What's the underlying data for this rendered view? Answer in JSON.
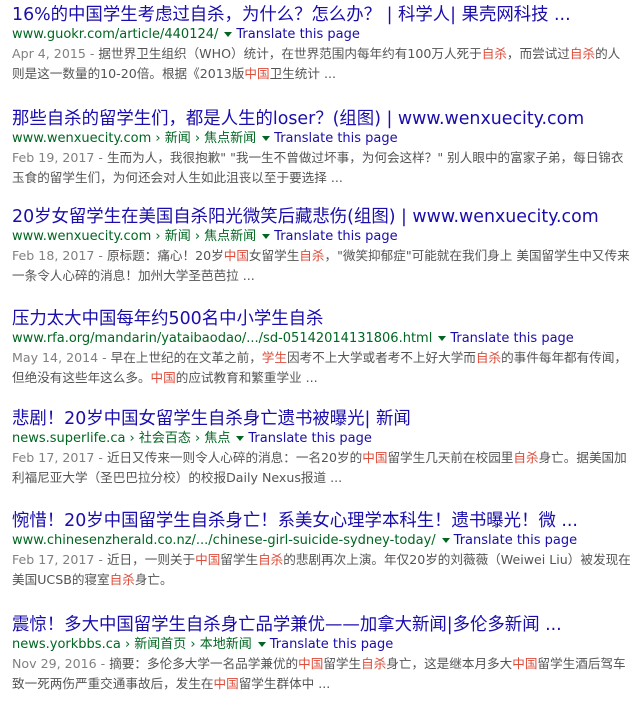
{
  "translate_label": "Translate this page",
  "results": [
    {
      "title": "16%的中国学生考虑过自杀，为什么？怎么办？ | 科学人| 果壳网科技 ...",
      "url": "www.guokr.com/article/440124/",
      "snippet": [
        {
          "t": "Apr 4, 2015 - ",
          "c": "date"
        },
        {
          "t": "据世界卫生组织（WHO）统计，在世界范围内每年约有100万人死于",
          "c": ""
        },
        {
          "t": "自杀",
          "c": "hl"
        },
        {
          "t": "，而尝试过",
          "c": ""
        },
        {
          "t": "自杀",
          "c": "hl"
        },
        {
          "t": "的人则是这一数量的10-20倍。根据《2013版",
          "c": ""
        },
        {
          "t": "中国",
          "c": "hl"
        },
        {
          "t": "卫生统计 ...",
          "c": ""
        }
      ]
    },
    {
      "title": "那些自杀的留学生们，都是人生的loser？(组图) | www.wenxuecity.com",
      "url": "www.wenxuecity.com › 新闻 › 焦点新闻",
      "snippet": [
        {
          "t": "Feb 19, 2017 - ",
          "c": "date"
        },
        {
          "t": "生而为人，我很抱歉\" \"我一生不曾做过坏事，为何会这样？\" 别人眼中的富家子弟，每日锦衣玉食的留学生们，为何还会对人生如此沮丧以至于要选择 ...",
          "c": ""
        }
      ]
    },
    {
      "title": "20岁女留学生在美国自杀阳光微笑后藏悲伤(组图) | www.wenxuecity.com",
      "url": "www.wenxuecity.com › 新闻 › 焦点新闻",
      "snippet": [
        {
          "t": "Feb 18, 2017 - ",
          "c": "date"
        },
        {
          "t": "原标题：痛心！20岁",
          "c": ""
        },
        {
          "t": "中国",
          "c": "hl"
        },
        {
          "t": "女留学生",
          "c": ""
        },
        {
          "t": "自杀",
          "c": "hl"
        },
        {
          "t": "，\"微笑抑郁症\"可能就在我们身上 美国留学生中又传来一条令人心碎的消息！加州大学圣芭芭拉 ...",
          "c": ""
        }
      ]
    },
    {
      "title": "压力太大中国每年约500名中小学生自杀",
      "url": "www.rfa.org/mandarin/yataibaodao/.../sd-05142014131806.html",
      "snippet": [
        {
          "t": "May 14, 2014 - ",
          "c": "date"
        },
        {
          "t": "早在上世纪的在文革之前，",
          "c": ""
        },
        {
          "t": "学生",
          "c": "hl"
        },
        {
          "t": "因考不上大学或者考不上好大学而",
          "c": ""
        },
        {
          "t": "自杀",
          "c": "hl"
        },
        {
          "t": "的事件每年都有传闻，但绝没有这些年这么多。",
          "c": ""
        },
        {
          "t": "中国",
          "c": "hl"
        },
        {
          "t": "的应试教育和繁重学业 ...",
          "c": ""
        }
      ]
    },
    {
      "title": "悲剧！20岁中国女留学生自杀身亡遗书被曝光| 新闻",
      "url": "news.superlife.ca › 社会百态 › 焦点",
      "snippet": [
        {
          "t": "Feb 17, 2017 - ",
          "c": "date"
        },
        {
          "t": "近日又传来一则令人心碎的消息：一名20岁的",
          "c": ""
        },
        {
          "t": "中国",
          "c": "hl"
        },
        {
          "t": "留学生几天前在校园里",
          "c": ""
        },
        {
          "t": "自杀",
          "c": "hl"
        },
        {
          "t": "身亡。据美国加利福尼亚大学（圣巴巴拉分校）的校报Daily Nexus报道 ...",
          "c": ""
        }
      ]
    },
    {
      "title": "惋惜！20岁中国留学生自杀身亡！系美女心理学本科生！遗书曝光！微 ...",
      "url": "www.chinesenzherald.co.nz/.../chinese-girl-suicide-sydney-today/",
      "snippet": [
        {
          "t": "Feb 17, 2017 - ",
          "c": "date"
        },
        {
          "t": "近日，一则关于",
          "c": ""
        },
        {
          "t": "中国",
          "c": "hl"
        },
        {
          "t": "留学生",
          "c": ""
        },
        {
          "t": "自杀",
          "c": "hl"
        },
        {
          "t": "的悲剧再次上演。年仅20岁的刘薇薇（Weiwei Liu）被发现在美国UCSB的寝室",
          "c": ""
        },
        {
          "t": "自杀",
          "c": "hl"
        },
        {
          "t": "身亡。",
          "c": ""
        }
      ]
    },
    {
      "title": "震惊！多大中国留学生自杀身亡品学兼优——加拿大新闻|多伦多新闻 ...",
      "url": "news.yorkbbs.ca › 新闻首页 › 本地新闻",
      "snippet": [
        {
          "t": "Nov 29, 2016 - ",
          "c": "date"
        },
        {
          "t": "摘要：多伦多大学一名品学兼优的",
          "c": ""
        },
        {
          "t": "中国",
          "c": "hl"
        },
        {
          "t": "留学生",
          "c": ""
        },
        {
          "t": "自杀",
          "c": "hl"
        },
        {
          "t": "身亡，这是继本月多大",
          "c": ""
        },
        {
          "t": "中国",
          "c": "hl"
        },
        {
          "t": "留学生酒后驾车致一死两伤严重交通事故后，发生在",
          "c": ""
        },
        {
          "t": "中国",
          "c": "hl"
        },
        {
          "t": "留学生群体中 ...",
          "c": ""
        }
      ]
    }
  ]
}
